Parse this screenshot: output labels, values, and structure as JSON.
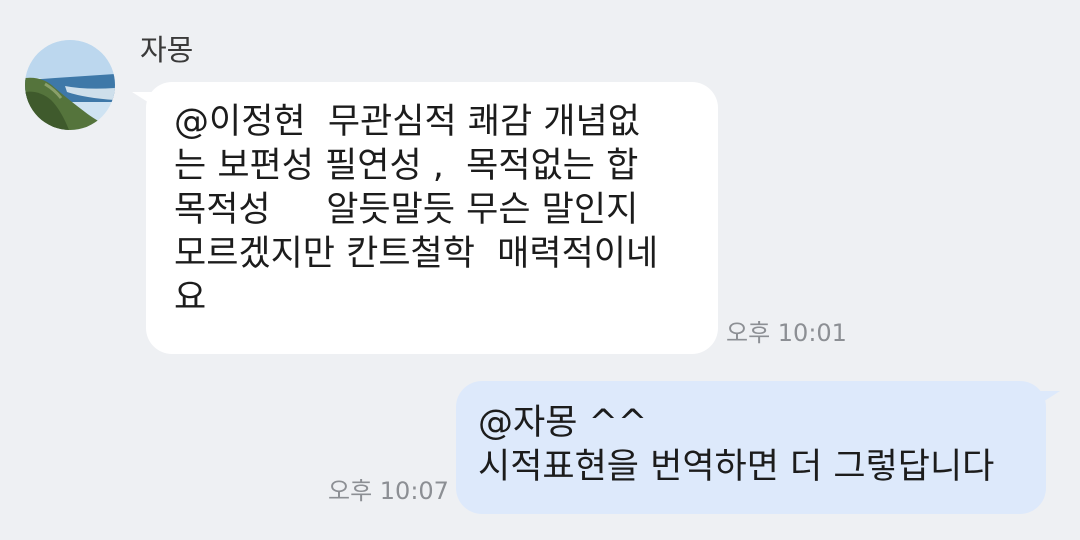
{
  "incoming": {
    "sender_name": "자몽",
    "avatar_icon": "landscape-coast-avatar",
    "message_lines": [
      "@이정현  무관심적 쾌감 개념없",
      "는 보편성 필연성 ,  목적없는 합",
      "목적성     알듯말듯 무슨 말인지",
      "모르겠지만 칸트철학  매력적이네",
      "요"
    ],
    "time": "오후 10:01",
    "bubble_color": "#ffffff"
  },
  "outgoing": {
    "message_lines": [
      "@자몽 ^^",
      "시적표현을 번역하면 더 그렇답니다"
    ],
    "time": "오후 10:07",
    "bubble_color": "#dde9fb"
  },
  "colors": {
    "background": "#eef0f3",
    "timestamp": "#8c8f94"
  }
}
